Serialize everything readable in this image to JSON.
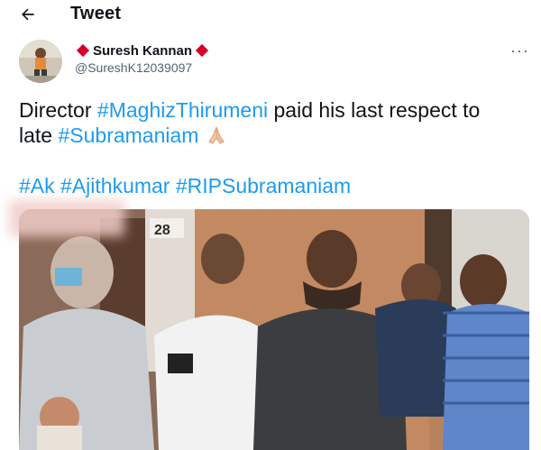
{
  "header": {
    "title": "Tweet",
    "back_icon": "arrow-left-icon"
  },
  "tweet": {
    "author_name": "Suresh Kannan",
    "author_handle": "@SureshK12039097",
    "name_decoration_icon": "red-diamond-icon",
    "more_icon": "ellipsis-icon",
    "text": {
      "prefix": "Director",
      "hashtag_1": "#MaghizThirumeni",
      "middle": "paid his last respect to",
      "line2_prefix": "late",
      "hashtag_2": "#Subramaniam",
      "emoji": "folded-hands-emoji",
      "tags": [
        "#Ak",
        "#Ajithkumar",
        "#RIPSubramaniam"
      ]
    },
    "media": {
      "door_number": "28"
    }
  },
  "colors": {
    "accent": "#1d9bf0",
    "diamond": "#d4002a",
    "text": "#0f1419",
    "muted": "#536471"
  }
}
